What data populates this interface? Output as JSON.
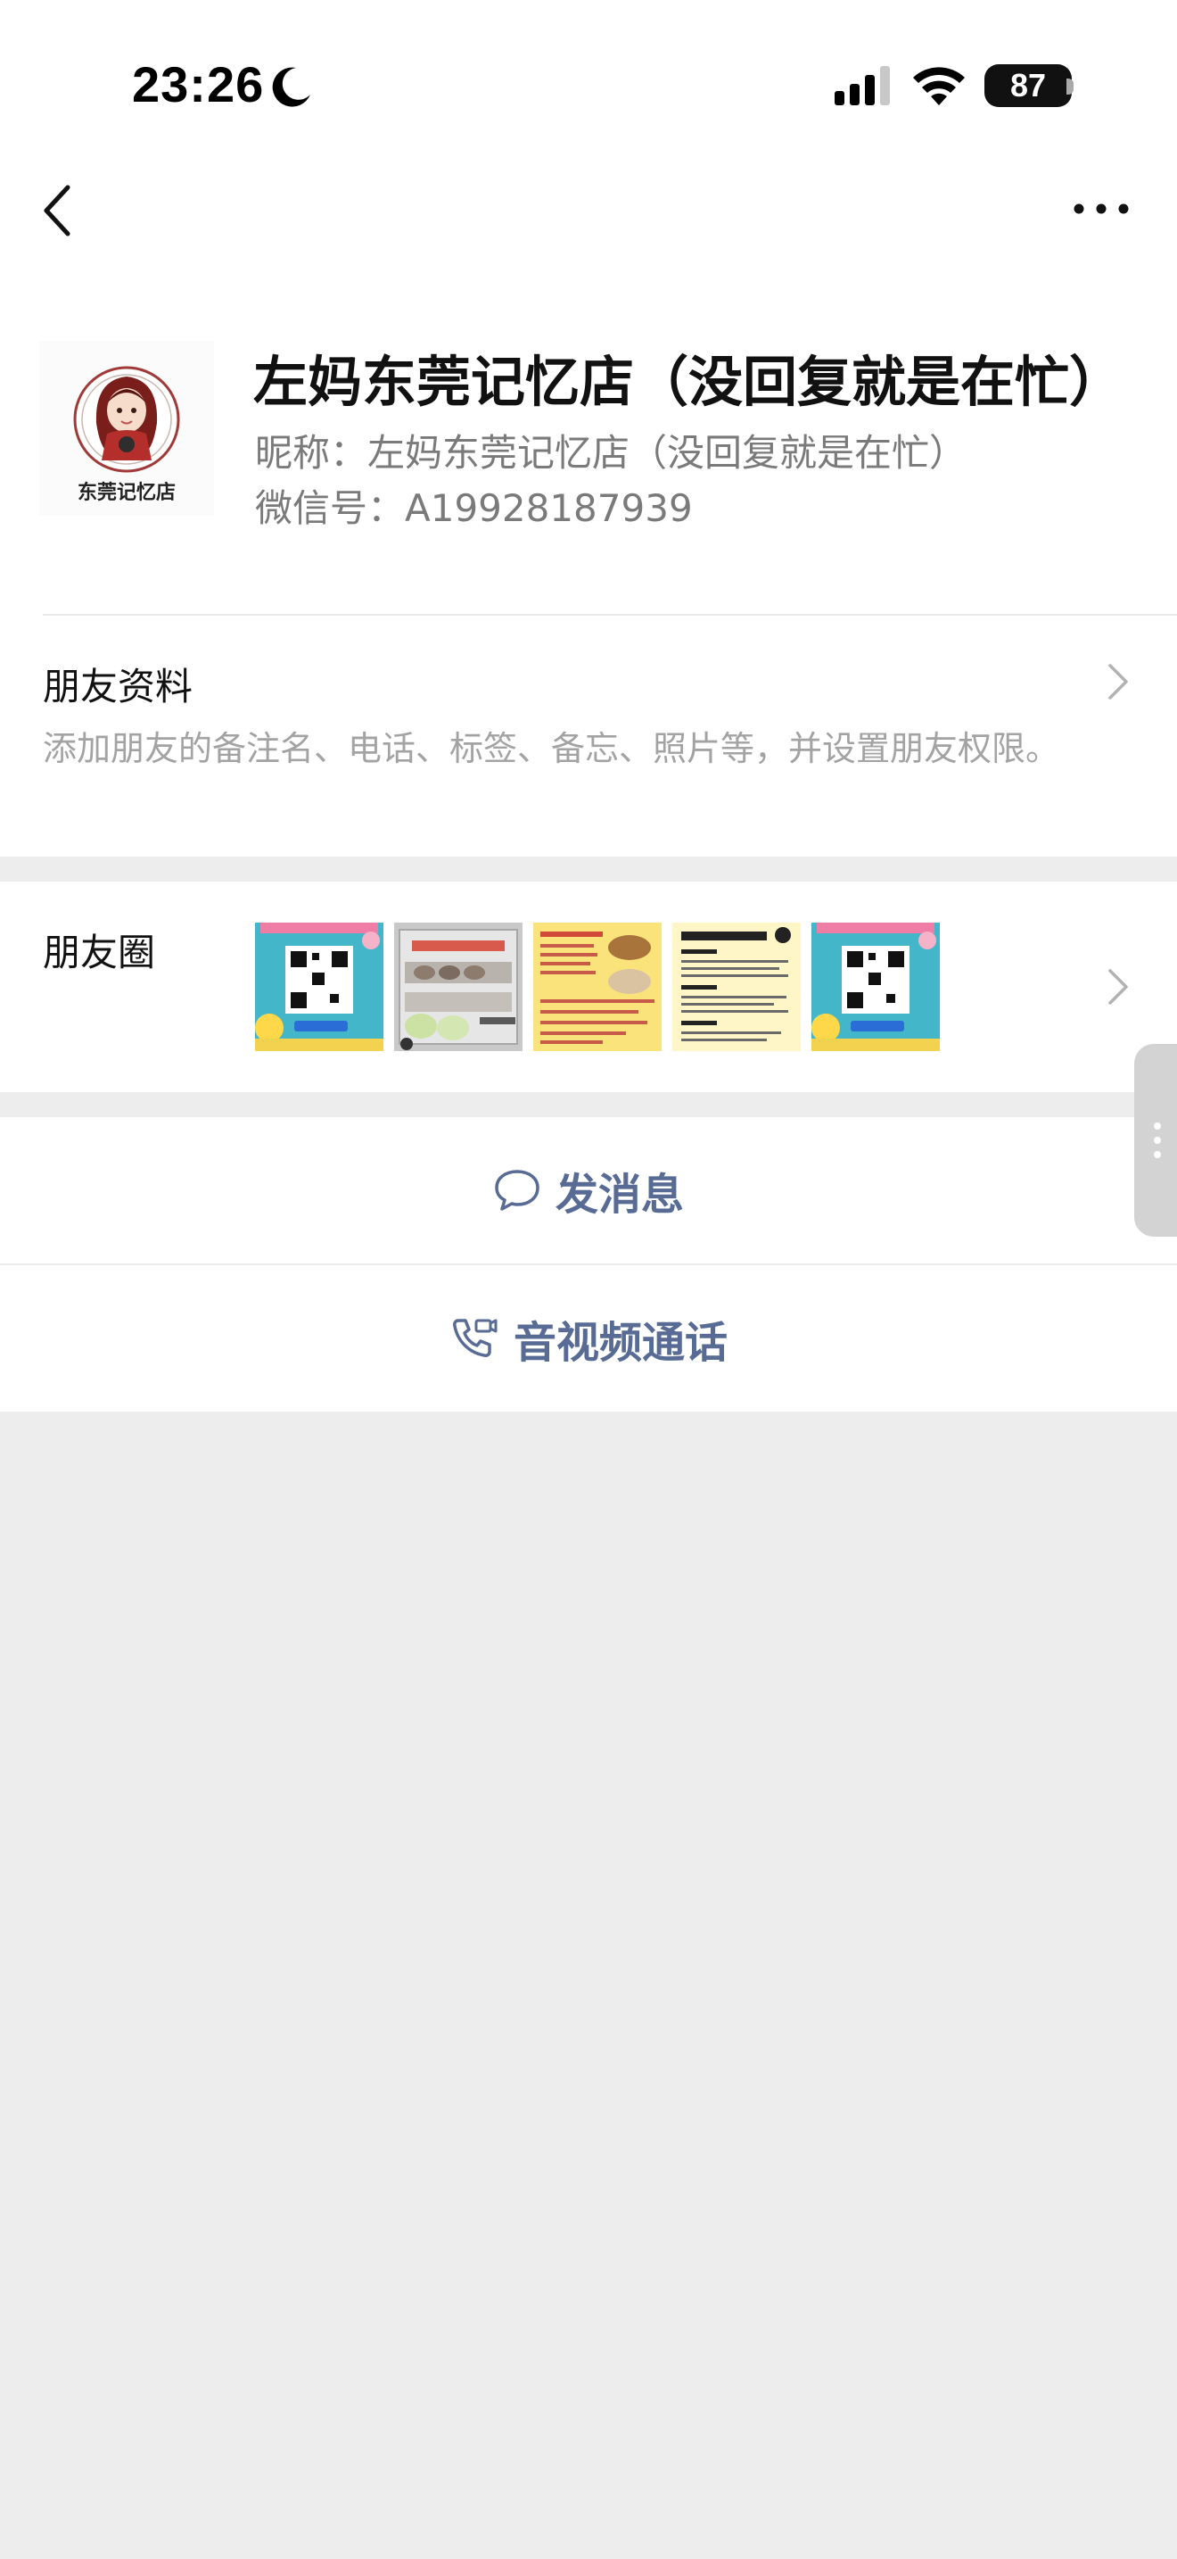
{
  "status_bar": {
    "time": "23:26",
    "battery": "87",
    "icons": [
      "moon-icon",
      "signal-icon",
      "wifi-icon",
      "battery-icon"
    ]
  },
  "nav": {
    "back_icon": "chevron-left-icon",
    "more_icon": "ellipsis-icon"
  },
  "profile": {
    "display_name": "左妈东莞记忆店（没回复就是在忙）",
    "nickname": "昵称：左妈东莞记忆店（没回复就是在忙）",
    "wechat_id": "微信号：A19928187939",
    "avatar_caption": "东莞记忆店"
  },
  "friend_info": {
    "title": "朋友资料",
    "description": "添加朋友的备注名、电话、标签、备忘、照片等，并设置朋友权限。"
  },
  "moments": {
    "title": "朋友圈",
    "thumbnail_count": 5
  },
  "actions": {
    "message_label": "发消息",
    "call_label": "音视频通话"
  },
  "colors": {
    "link_blue": "#576b95",
    "background_grey": "#ededed",
    "secondary_text": "#7a7a7a",
    "hint_text": "#a3a3a3"
  }
}
